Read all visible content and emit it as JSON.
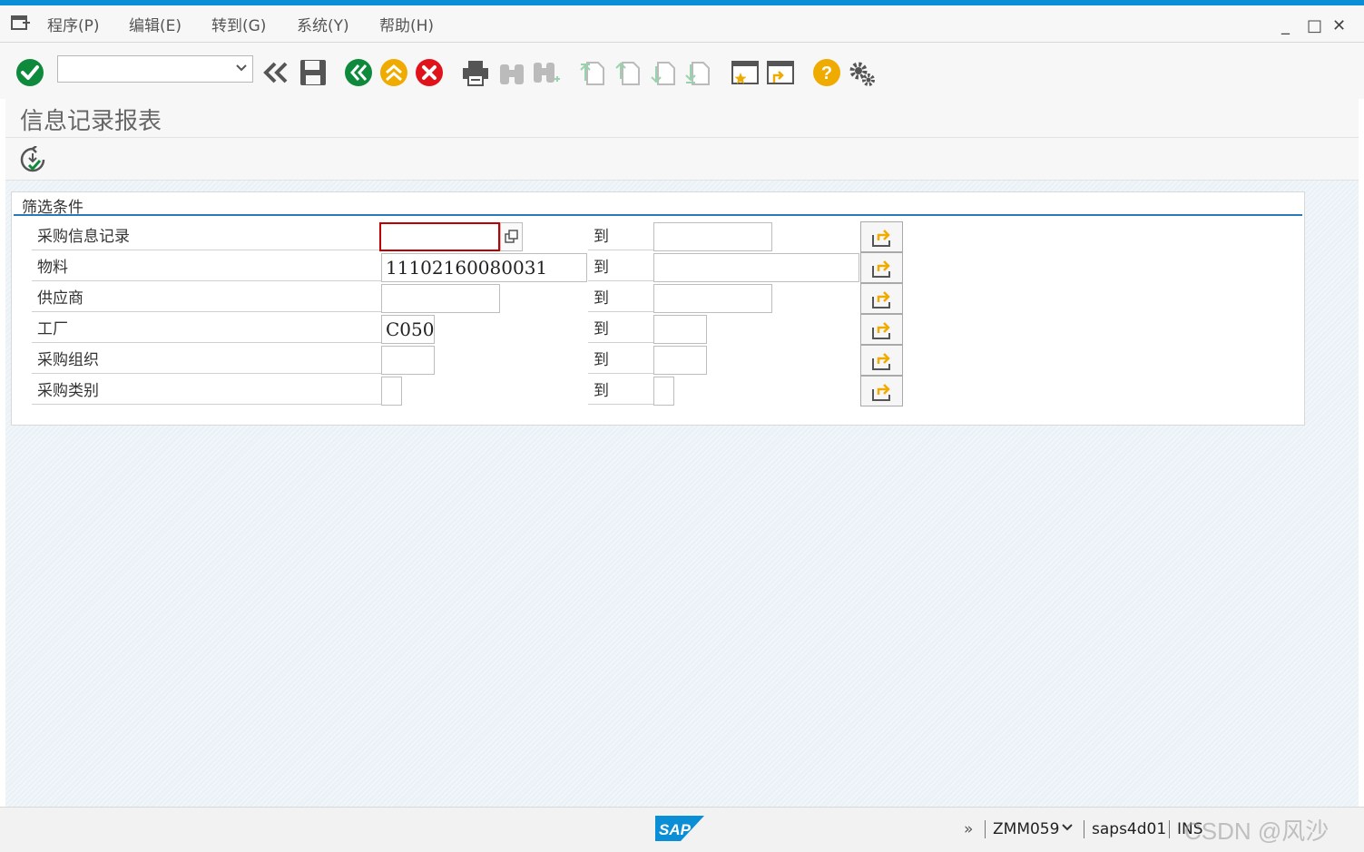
{
  "menubar": {
    "items": [
      "程序(P)",
      "编辑(E)",
      "转到(G)",
      "系统(Y)",
      "帮助(H)"
    ]
  },
  "window": {
    "minimize": "_",
    "maximize": "□",
    "close": "✕"
  },
  "toolbar": {
    "command_field_value": "",
    "icons": [
      "enter-icon",
      "back-chevron-icon",
      "save-icon",
      "back-icon",
      "exit-icon",
      "cancel-icon",
      "print-icon",
      "find-icon",
      "find-next-icon",
      "first-page-icon",
      "previous-page-icon",
      "next-page-icon",
      "last-page-icon",
      "new-session-icon",
      "shortcut-icon",
      "help-icon",
      "settings-icon"
    ]
  },
  "page": {
    "title": "信息记录报表"
  },
  "app_toolbar": {
    "execute_icon": "execute-icon"
  },
  "selection": {
    "group_title": "筛选条件",
    "to_label": "到",
    "rows": [
      {
        "label": "采购信息记录",
        "low": "",
        "high": ""
      },
      {
        "label": "物料",
        "low": "11102160080031",
        "high": ""
      },
      {
        "label": "供应商",
        "low": "",
        "high": ""
      },
      {
        "label": "工厂",
        "low": "C050",
        "high": ""
      },
      {
        "label": "采购组织",
        "low": "",
        "high": ""
      },
      {
        "label": "采购类别",
        "low": "",
        "high": ""
      }
    ]
  },
  "statusbar": {
    "transaction": "ZMM059",
    "system": "saps4d01",
    "mode": "INS",
    "logo": "SAP",
    "expand": "»",
    "watermark": "CSDN @风沙"
  },
  "colors": {
    "accent": "#0a8fd6",
    "ok_green": "#0f8a3c",
    "back_green": "#0f8a3c",
    "exit_yellow": "#f0ab00",
    "cancel_red": "#e0121a",
    "help_yellow": "#f0ab00",
    "section_line": "#2a7ab8"
  }
}
